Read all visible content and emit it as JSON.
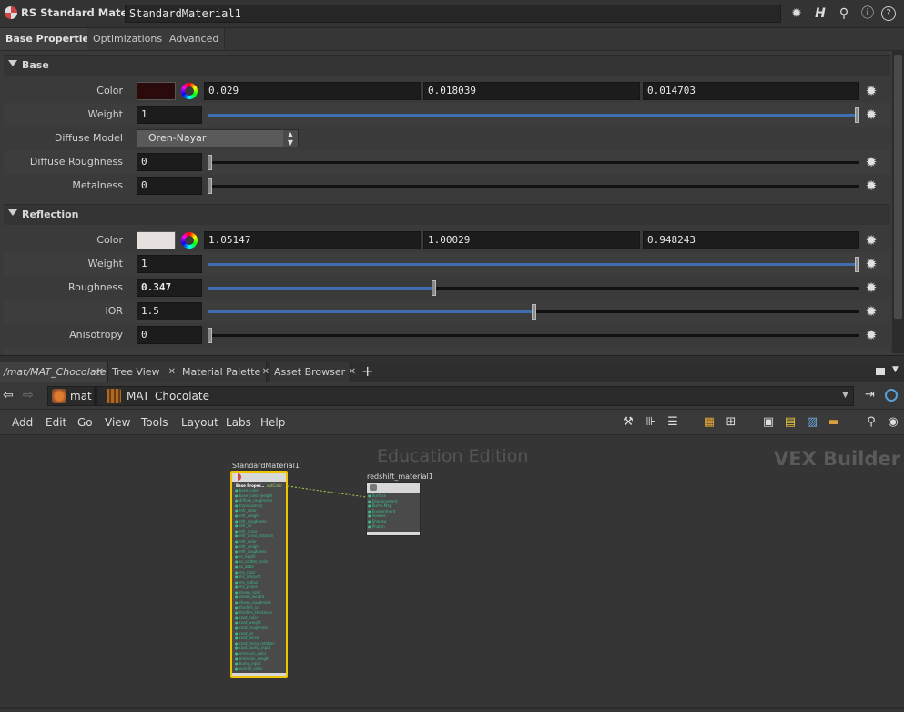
{
  "header": {
    "node_type": "RS Standard Material",
    "node_name": "StandardMaterial1",
    "icons": [
      "gear-icon",
      "houdini-help-icon",
      "search-icon",
      "info-icon",
      "help-icon"
    ],
    "icon_glyphs": [
      "✹",
      "H",
      "⚲",
      "ⓘ",
      "?"
    ]
  },
  "tabs": [
    "Base Properties",
    "Optimizations",
    "Advanced"
  ],
  "base": {
    "title": "Base",
    "color_label": "Color",
    "color_swatch": "#2a0a0a",
    "color_values": [
      "0.029",
      "0.018039",
      "0.014703"
    ],
    "weight_label": "Weight",
    "weight_value": "1",
    "weight_fraction": 1.0,
    "diffuse_model_label": "Diffuse Model",
    "diffuse_model_value": "Oren-Nayar",
    "diffuse_roughness_label": "Diffuse Roughness",
    "diffuse_roughness_value": "0",
    "diffuse_roughness_fraction": 0,
    "metalness_label": "Metalness",
    "metalness_value": "0",
    "metalness_fraction": 0
  },
  "reflection": {
    "title": "Reflection",
    "color_label": "Color",
    "color_swatch": "#e6e1de",
    "color_values": [
      "1.05147",
      "1.00029",
      "0.948243"
    ],
    "weight_label": "Weight",
    "weight_value": "1",
    "weight_fraction": 1.0,
    "roughness_label": "Roughness",
    "roughness_value": "0.347",
    "roughness_fraction": 0.347,
    "ior_label": "IOR",
    "ior_value": "1.5",
    "ior_fraction": 0.5,
    "anisotropy_label": "Anisotropy",
    "anisotropy_value": "0",
    "anisotropy_fraction": 0
  },
  "network_tabs": [
    {
      "label": "/mat/MAT_Chocolate"
    },
    {
      "label": "Tree View"
    },
    {
      "label": "Material Palette"
    },
    {
      "label": "Asset Browser"
    }
  ],
  "path": {
    "root": "mat",
    "current": "MAT_Chocolate"
  },
  "menu": [
    "Add",
    "Edit",
    "Go",
    "View",
    "Tools",
    "Layout",
    "Labs",
    "Help"
  ],
  "canvas": {
    "watermark_edition": "Education Edition",
    "watermark_context": "VEX Builder",
    "node1": {
      "name": "StandardMaterial1",
      "header_label": "Base Proper...",
      "output_label": "outColor",
      "inputs": [
        "base_color",
        "base_color_weight",
        "diffuse_roughness",
        "translucency",
        "refr_color",
        "refr_weight",
        "refr_roughness",
        "refr_ior",
        "refr_aniso",
        "refr_aniso_rotation",
        "refr_color",
        "refr_weight",
        "refr_roughness",
        "ss_depth",
        "ss_scatter_color",
        "ss_abbe",
        "ms_color",
        "ms_amount",
        "ms_radius",
        "ms_phase",
        "sheen_color",
        "sheen_weight",
        "sheen_roughness",
        "thinfilm_ior",
        "thinfilm_thickness",
        "coat_color",
        "coat_weight",
        "coat_roughness",
        "coat_ior",
        "coat_aniso",
        "coat_aniso_rotation",
        "coat_bump_input",
        "emission_color",
        "emission_weight",
        "bump_input",
        "overall_color"
      ]
    },
    "node2": {
      "name": "redshift_material1",
      "inputs": [
        "Surface",
        "Displacement",
        "Bump Map",
        "Environment",
        "Volume",
        "Shadow",
        "Photon"
      ]
    }
  },
  "colors": {
    "accent_blue": "#3d6fb0",
    "selected_node": "#f0c400",
    "wire": "#a6d64a"
  }
}
